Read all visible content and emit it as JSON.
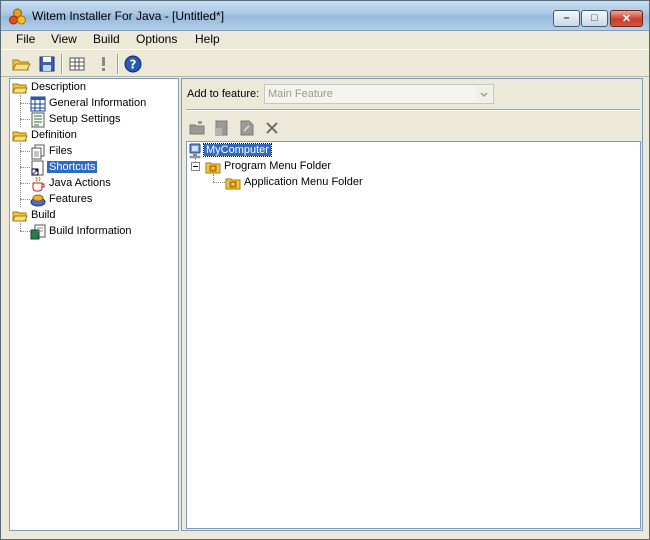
{
  "window": {
    "title": "Witem Installer For Java - [Untitled*]",
    "controls": {
      "minimize": "–",
      "maximize": "□",
      "close": "✕"
    }
  },
  "menu": [
    "File",
    "View",
    "Build",
    "Options",
    "Help"
  ],
  "toolbar": {
    "buttons": [
      "open-folder-icon",
      "save-icon",
      "build-grid-icon",
      "run-icon",
      "help-icon"
    ]
  },
  "nav_tree": {
    "groups": [
      {
        "label": "Description",
        "items": [
          "General Information",
          "Setup Settings"
        ]
      },
      {
        "label": "Definition",
        "items": [
          "Files",
          "Shortcuts",
          "Java Actions",
          "Features"
        ]
      },
      {
        "label": "Build",
        "items": [
          "Build Information"
        ]
      }
    ],
    "selected": "Shortcuts"
  },
  "shortcuts_panel": {
    "feature_label": "Add to feature:",
    "feature_value": "Main Feature",
    "tree": {
      "root": "MyComputer",
      "child": "Program Menu Folder",
      "grandchild": "Application Menu Folder"
    }
  },
  "colors": {
    "selection": "#316ac5",
    "folder": "#f5c542",
    "panel_border": "#7f9db9"
  }
}
